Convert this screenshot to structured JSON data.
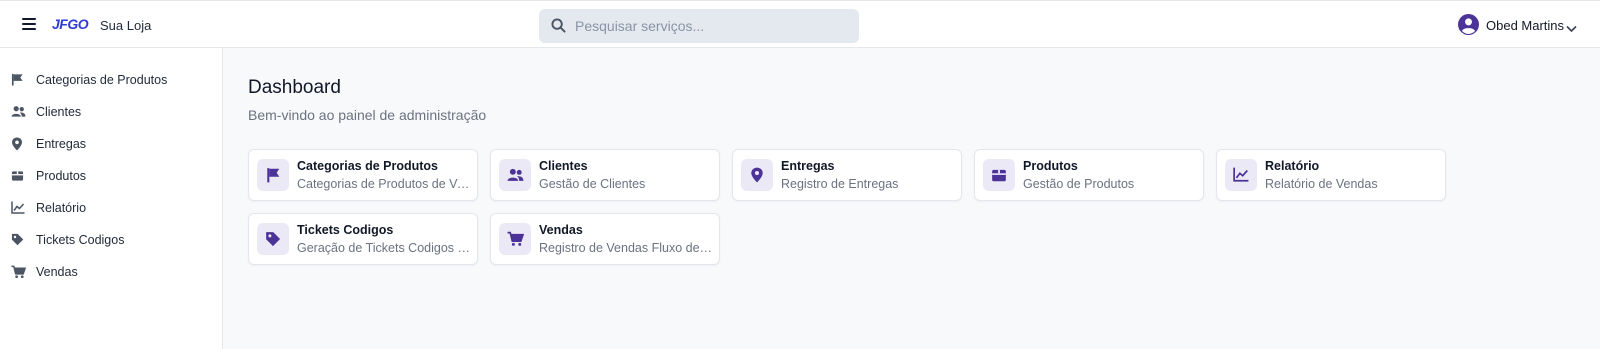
{
  "header": {
    "logo_text": "JFGO",
    "store_name": "Sua Loja",
    "search_placeholder": "Pesquisar serviços...",
    "user_name": "Obed Martins"
  },
  "sidebar": {
    "items": [
      {
        "label": "Categorias de Produtos",
        "icon": "flag-icon"
      },
      {
        "label": "Clientes",
        "icon": "users-icon"
      },
      {
        "label": "Entregas",
        "icon": "map-pin-icon"
      },
      {
        "label": "Produtos",
        "icon": "box-icon"
      },
      {
        "label": "Relatório",
        "icon": "chart-line-icon"
      },
      {
        "label": "Tickets Codigos",
        "icon": "tag-icon"
      },
      {
        "label": "Vendas",
        "icon": "cart-icon"
      }
    ]
  },
  "main": {
    "title": "Dashboard",
    "subtitle": "Bem-vindo ao painel de administração",
    "cards": [
      {
        "title": "Categorias de Produtos",
        "description": "Categorias de Produtos de Ve...",
        "icon": "flag-icon"
      },
      {
        "title": "Clientes",
        "description": "Gestão de Clientes",
        "icon": "users-icon"
      },
      {
        "title": "Entregas",
        "description": "Registro de Entregas",
        "icon": "map-pin-icon"
      },
      {
        "title": "Produtos",
        "description": "Gestão de Produtos",
        "icon": "box-icon"
      },
      {
        "title": "Relatório",
        "description": "Relatório de Vendas",
        "icon": "chart-line-icon"
      },
      {
        "title": "Tickets Codigos",
        "description": "Geração de Tickets Codigos de...",
        "icon": "tag-icon"
      },
      {
        "title": "Vendas",
        "description": "Registro de Vendas Fluxo de C...",
        "icon": "cart-icon"
      }
    ]
  },
  "colors": {
    "accent": "#4c3398",
    "logo": "#2f3bd6",
    "sidebar_icon": "#4b5563",
    "card_icon_bg": "#ece9f7",
    "search_bg": "#e4e8ef"
  }
}
